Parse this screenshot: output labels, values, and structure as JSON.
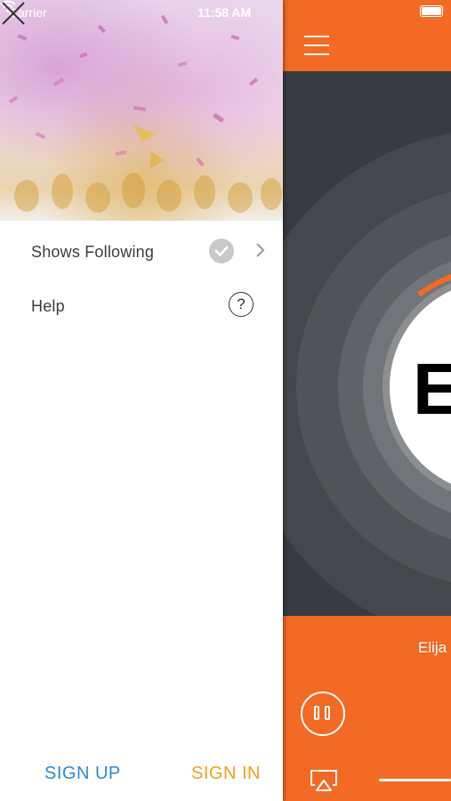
{
  "status_bar": {
    "carrier": "Carrier",
    "time": "11:58 AM"
  },
  "drawer": {
    "menu": [
      {
        "label": "Shows Following"
      },
      {
        "label": "Help"
      }
    ],
    "help_glyph": "?",
    "sign_up_label": "SIGN UP",
    "sign_in_label": "SIGN IN"
  },
  "player": {
    "logo_text": "E",
    "track_title": "Elija"
  },
  "colors": {
    "accent_orange": "#f26a23",
    "sign_up_blue": "#2d8ad8",
    "sign_in_gold": "#f0a11c",
    "artwork_dark": "#383c40"
  },
  "icons": [
    "wifi-icon",
    "close-icon",
    "check-icon",
    "chevron-right-icon",
    "help-icon",
    "menu-icon",
    "battery-icon",
    "pause-icon",
    "airplay-icon"
  ]
}
